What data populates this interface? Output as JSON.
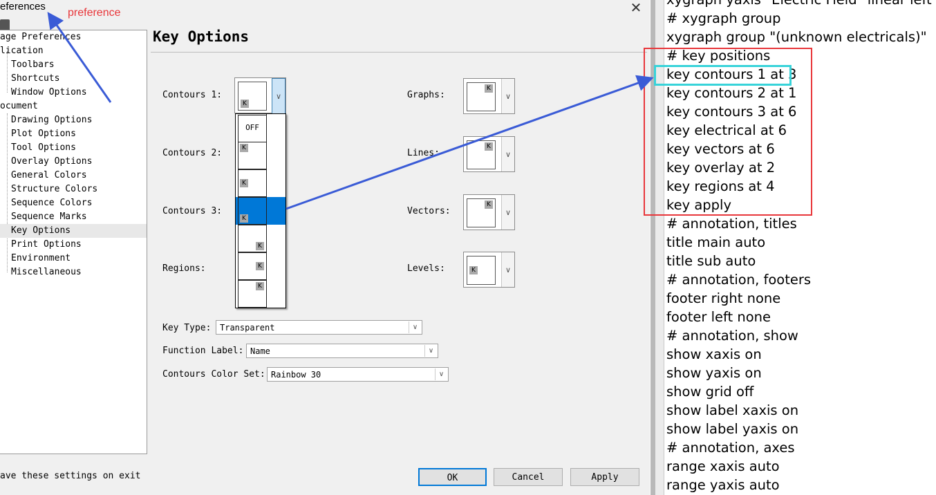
{
  "window": {
    "title": "eferences",
    "annotation": "preference",
    "close_glyph": "✕"
  },
  "tree": {
    "items": [
      {
        "label": "age Preferences"
      },
      {
        "label": "lication"
      },
      {
        "label": "Toolbars"
      },
      {
        "label": "Shortcuts"
      },
      {
        "label": "Window Options"
      },
      {
        "label": "ocument"
      },
      {
        "label": "Drawing Options"
      },
      {
        "label": "Plot Options"
      },
      {
        "label": "Tool Options"
      },
      {
        "label": "Overlay Options"
      },
      {
        "label": "General Colors"
      },
      {
        "label": "Structure Colors"
      },
      {
        "label": "Sequence Colors"
      },
      {
        "label": "Sequence Marks"
      },
      {
        "label": "Key Options",
        "selected": true
      },
      {
        "label": "Print Options"
      },
      {
        "label": "Environment"
      },
      {
        "label": "Miscellaneous"
      }
    ]
  },
  "panel": {
    "title": "Key Options",
    "labels": {
      "contours1": "Contours 1:",
      "contours2": "Contours 2:",
      "contours3": "Contours 3:",
      "regions": "Regions:",
      "graphs": "Graphs:",
      "lines": "Lines:",
      "vectors": "Vectors:",
      "levels": "Levels:"
    },
    "badge": "K",
    "dropdown": {
      "off_label": "OFF"
    },
    "key_type": {
      "label": "Key Type:",
      "value": "Transparent"
    },
    "function_label": {
      "label": "Function Label:",
      "value": "Name"
    },
    "color_set": {
      "label": "Contours Color Set:",
      "value": "Rainbow 30"
    }
  },
  "footer": {
    "save_text": "ave these settings on exit",
    "ok": "OK",
    "cancel": "Cancel",
    "apply": "Apply"
  },
  "script": {
    "lines": [
      "xygraph yaxis \"Electric Field\" linear  left",
      "# xygraph group",
      "xygraph group \"(unknown electricals)\"",
      "# key positions",
      "key contours 1 at 3",
      "key contours 2 at 1",
      "key contours 3 at 6",
      "key electrical at 6",
      "key vectors at 6",
      "key overlay at 2",
      "key regions at 4",
      "key apply",
      "# annotation, titles",
      "title main auto",
      "title sub auto",
      "# annotation, footers",
      "footer right none",
      "footer left none",
      "# annotation, show",
      "show xaxis on",
      "show yaxis on",
      "show grid off",
      "show label xaxis on",
      "show label yaxis on",
      "# annotation, axes",
      "range xaxis auto",
      "range yaxis auto"
    ]
  },
  "colors": {
    "highlight_blue": "#0078d7",
    "annotation_red": "#e8363a",
    "annotation_cyan": "#37d3d9",
    "arrow_blue": "#3a5bd6"
  }
}
